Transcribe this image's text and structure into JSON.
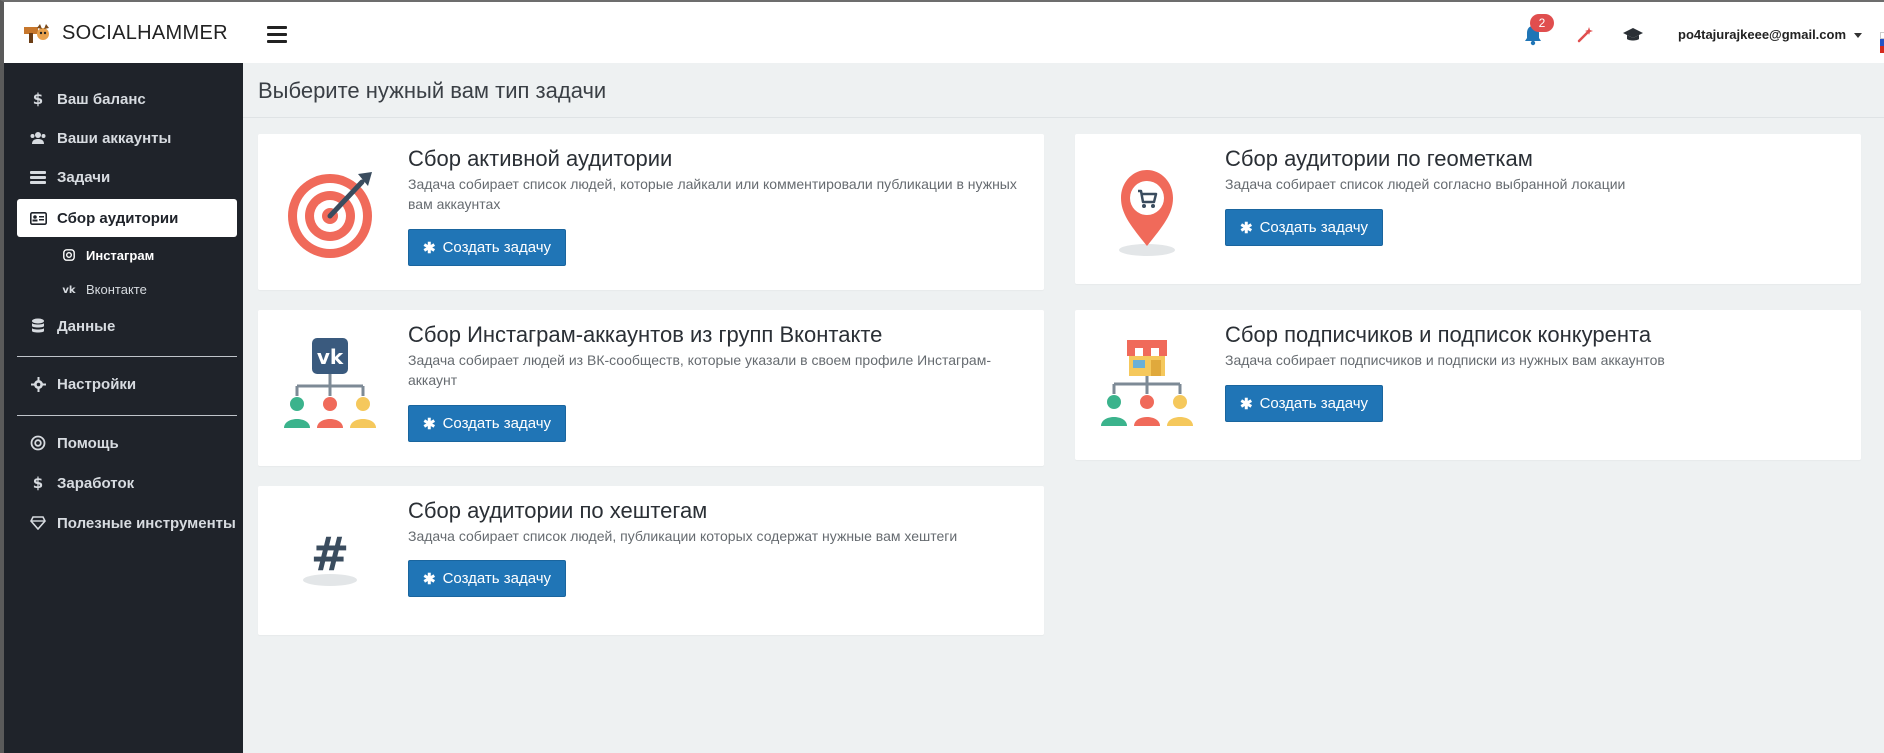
{
  "app": {
    "name": "SOCIALHAMMER"
  },
  "topbar": {
    "notifications_count": "2",
    "user_email": "po4tajurajkeee@gmail.com",
    "icons": [
      "bell-icon",
      "magic-wand-icon",
      "graduation-cap-icon"
    ]
  },
  "sidebar": {
    "items": [
      {
        "label": "Ваш баланс",
        "icon": "dollar-icon"
      },
      {
        "label": "Ваши аккаунты",
        "icon": "users-icon"
      },
      {
        "label": "Задачи",
        "icon": "tasks-icon"
      },
      {
        "label": "Сбор аудитории",
        "icon": "id-card-icon",
        "active": true
      },
      {
        "label": "Данные",
        "icon": "database-icon"
      },
      {
        "label": "Настройки",
        "icon": "gear-icon"
      },
      {
        "label": "Помощь",
        "icon": "life-ring-icon"
      },
      {
        "label": "Заработок",
        "icon": "dollar-icon"
      },
      {
        "label": "Полезные инструменты",
        "icon": "diamond-icon"
      }
    ],
    "sub_items": [
      {
        "label": "Инстаграм",
        "icon": "instagram-icon",
        "active": true
      },
      {
        "label": "Вконтакте",
        "icon": "vk-icon"
      }
    ]
  },
  "main": {
    "title": "Выберите нужный вам тип задачи",
    "button_label": "Создать задачу",
    "cards": [
      {
        "title": "Сбор активной аудитории",
        "description": "Задача собирает список людей, которые лайкали или комментировали публикации в нужных вам аккаунтах",
        "illustration": "target-icon"
      },
      {
        "title": "Сбор аудитории по геометкам",
        "description": "Задача собирает список людей согласно выбранной локации",
        "illustration": "map-pin-cart-icon"
      },
      {
        "title": "Сбор Инстаграм-аккаунтов из групп Вконтакте",
        "description": "Задача собирает людей из ВК-сообществ, которые указали в своем профиле Инстаграм-аккаунт",
        "illustration": "vk-group-tree-icon"
      },
      {
        "title": "Сбор подписчиков и подписок конкурента",
        "description": "Задача собирает подписчиков и подписки из нужных вам аккаунтов",
        "illustration": "shop-tree-icon"
      },
      {
        "title": "Сбор аудитории по хештегам",
        "description": "Задача собирает список людей, публикации которых содержат нужные вам хештеги",
        "illustration": "hashtag-icon"
      }
    ]
  },
  "colors": {
    "sidebar_bg": "#1f232a",
    "primary_button": "#2075b6",
    "badge": "#e04e4e",
    "page_bg": "#eef1f2"
  }
}
